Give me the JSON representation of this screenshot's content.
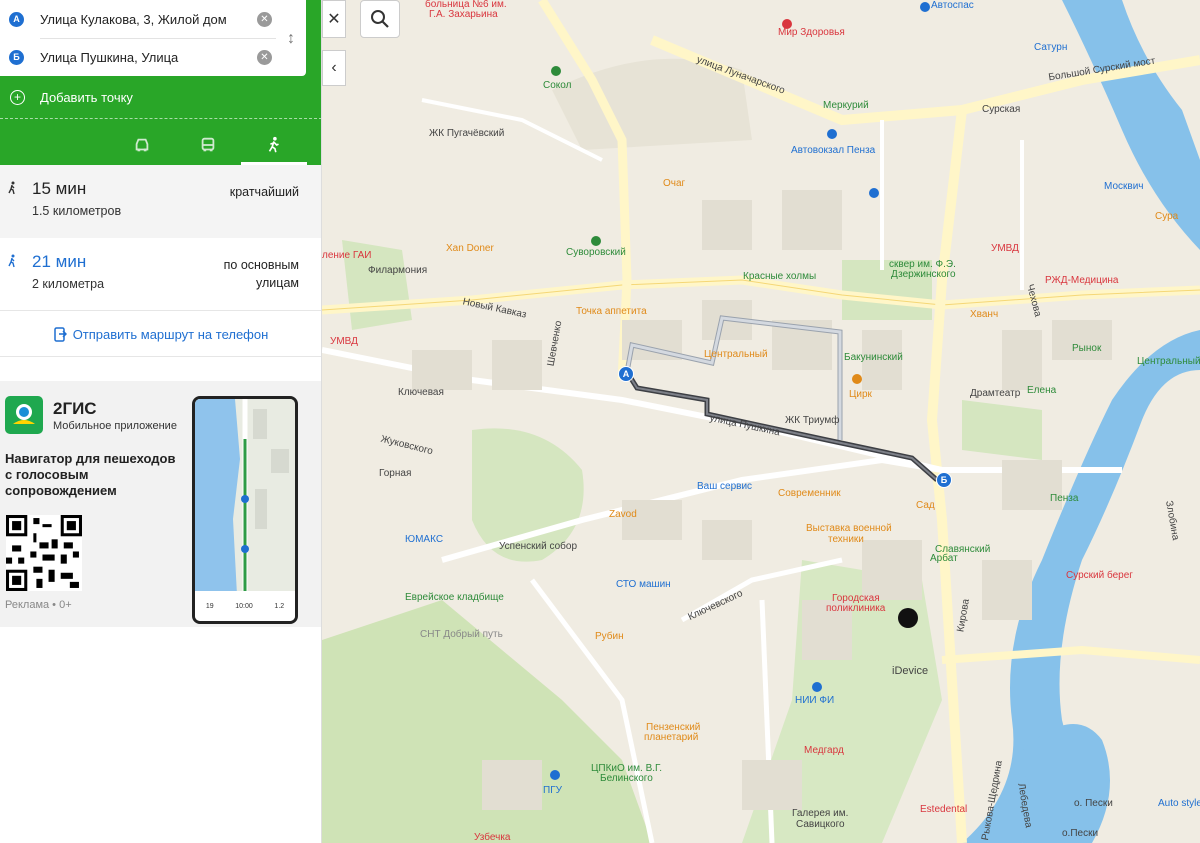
{
  "route_panel": {
    "point_a": {
      "badge": "А",
      "text": "Улица Кулакова, 3, Жилой дом"
    },
    "point_b": {
      "badge": "Б",
      "text": "Улица Пушкина, Улица"
    },
    "add_point_label": "Добавить точку",
    "modes": [
      {
        "name": "car",
        "active": false
      },
      {
        "name": "bus",
        "active": false
      },
      {
        "name": "walk",
        "active": true
      }
    ]
  },
  "variants": [
    {
      "time": "15 мин",
      "distance": "1.5 километров",
      "tag": "кратчайший"
    },
    {
      "time": "21 мин",
      "distance": "2 километра",
      "tag_line1": "по основным",
      "tag_line2": "улицам"
    }
  ],
  "send_to_phone": "Отправить маршрут на телефон",
  "ad": {
    "brand": "2ГИС",
    "subtitle": "Мобильное приложение",
    "headline": "Навигатор для пешеходов с голосовым сопровождением",
    "footer": "Реклама • 0+",
    "phone_stats": [
      "19",
      "10:00",
      "1.2"
    ]
  },
  "map_buttons": {
    "close": "✕",
    "collapse": "‹"
  },
  "map_labels": [
    {
      "t": "больница №6 им.",
      "c": "r"
    },
    {
      "t": "Г.А. Захарьина",
      "c": "r"
    },
    {
      "t": "Автоспас",
      "c": "b"
    },
    {
      "t": "Мир Здоровья",
      "c": "r"
    },
    {
      "t": "Сатурн",
      "c": "b"
    },
    {
      "t": "Большой Сурский мост",
      "c": "k"
    },
    {
      "t": "улица Луначарского",
      "c": "k"
    },
    {
      "t": "Сокол",
      "c": "g"
    },
    {
      "t": "Меркурий",
      "c": "g"
    },
    {
      "t": "Сурская",
      "c": "k"
    },
    {
      "t": "ЖК Пугачёвский",
      "c": "k"
    },
    {
      "t": "Автовокзал Пенза",
      "c": "b"
    },
    {
      "t": "Очаг",
      "c": "o"
    },
    {
      "t": "Москвич",
      "c": "b"
    },
    {
      "t": "Сура",
      "c": "o"
    },
    {
      "t": "Xan Doner",
      "c": "o"
    },
    {
      "t": "Суворовский",
      "c": "g"
    },
    {
      "t": "УМВД",
      "c": "r"
    },
    {
      "t": "ление ГАИ",
      "c": "r"
    },
    {
      "t": "Филармония",
      "c": "k"
    },
    {
      "t": "Красные холмы",
      "c": "g"
    },
    {
      "t": "сквер им. Ф.Э.",
      "c": "g"
    },
    {
      "t": "Дзержинского",
      "c": "g"
    },
    {
      "t": "РЖД-Медицина",
      "c": "r"
    },
    {
      "t": "Новый Кавказ",
      "c": "k"
    },
    {
      "t": "Точка аппетита",
      "c": "o"
    },
    {
      "t": "Хванч",
      "c": "o"
    },
    {
      "t": "Чехова",
      "c": "k"
    },
    {
      "t": "УМВД",
      "c": "r"
    },
    {
      "t": "Шевченко",
      "c": "k"
    },
    {
      "t": "Центральный",
      "c": "o"
    },
    {
      "t": "Бакунинский",
      "c": "g"
    },
    {
      "t": "Рынок",
      "c": "g"
    },
    {
      "t": "Центральный",
      "c": "g"
    },
    {
      "t": "Ключевая",
      "c": "k"
    },
    {
      "t": "Цирк",
      "c": "o"
    },
    {
      "t": "Драмтеатр",
      "c": "k"
    },
    {
      "t": "Елена",
      "c": "g"
    },
    {
      "t": "улица Пушкина",
      "c": "k"
    },
    {
      "t": "ЖК Триумф",
      "c": "k"
    },
    {
      "t": "Жуковского",
      "c": "k"
    },
    {
      "t": "Горная",
      "c": "k"
    },
    {
      "t": "Ваш сервис",
      "c": "b"
    },
    {
      "t": "Современник",
      "c": "o"
    },
    {
      "t": "Сад",
      "c": "o"
    },
    {
      "t": "Пенза",
      "c": "g"
    },
    {
      "t": "Zavod",
      "c": "o"
    },
    {
      "t": "Выставка военной",
      "c": "o"
    },
    {
      "t": "техники",
      "c": "o"
    },
    {
      "t": "Злобина",
      "c": "k"
    },
    {
      "t": "ЮМАКС",
      "c": "b"
    },
    {
      "t": "Успенский собор",
      "c": "k"
    },
    {
      "t": "Славянский",
      "c": "g"
    },
    {
      "t": "Арбат",
      "c": "g"
    },
    {
      "t": "Сурский берег",
      "c": "r"
    },
    {
      "t": "СТО машин",
      "c": "b"
    },
    {
      "t": "Еврейское кладбище",
      "c": "g"
    },
    {
      "t": "Городская",
      "c": "r"
    },
    {
      "t": "поликлиника",
      "c": "r"
    },
    {
      "t": "Ключевского",
      "c": "k"
    },
    {
      "t": "СНТ Добрый путь",
      "c": "k"
    },
    {
      "t": "Рубин",
      "c": "o"
    },
    {
      "t": "Кирова",
      "c": "k"
    },
    {
      "t": "iDevice",
      "c": "k"
    },
    {
      "t": "НИИ ФИ",
      "c": "b"
    },
    {
      "t": "Пензенский",
      "c": "o"
    },
    {
      "t": "планетарий",
      "c": "o"
    },
    {
      "t": "Медгард",
      "c": "r"
    },
    {
      "t": "ЦПКиО им. В.Г.",
      "c": "g"
    },
    {
      "t": "Белинского",
      "c": "g"
    },
    {
      "t": "ПГУ",
      "c": "b"
    },
    {
      "t": "Галерея им.",
      "c": "k"
    },
    {
      "t": "Савицкого",
      "c": "k"
    },
    {
      "t": "Estedental",
      "c": "r"
    },
    {
      "t": "о. Пески",
      "c": "k"
    },
    {
      "t": "о.Пески",
      "c": "k"
    },
    {
      "t": "Auto style",
      "c": "b"
    },
    {
      "t": "Рыкова-Щедрина",
      "c": "k"
    },
    {
      "t": "Лебедева",
      "c": "k"
    },
    {
      "t": "Узбечка",
      "c": "r"
    }
  ]
}
